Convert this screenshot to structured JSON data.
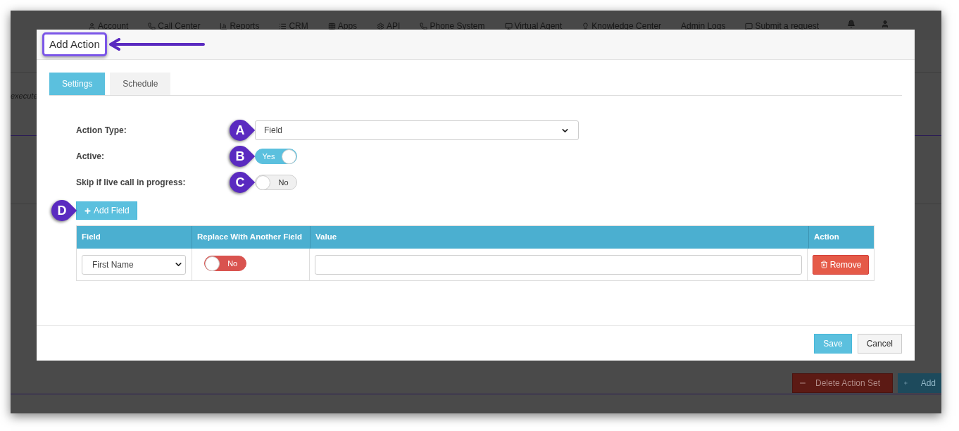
{
  "nav": {
    "items": [
      "Account",
      "Call Center",
      "Reports",
      "CRM",
      "Apps",
      "API",
      "Phone System",
      "Virtual Agent",
      "Knowledge Center",
      "Admin Logs",
      "Submit a request"
    ]
  },
  "background": {
    "note": "execute",
    "buttons": [
      "Delete Action Set",
      "Add"
    ]
  },
  "modal": {
    "title": "Add Action",
    "tabs": [
      {
        "label": "Settings",
        "selected": true
      },
      {
        "label": "Schedule",
        "selected": false
      }
    ],
    "form": [
      {
        "label": "Action Type:",
        "kind": "select",
        "value": "Field",
        "marker": "A"
      },
      {
        "label": "Active:",
        "kind": "toggle",
        "on": true,
        "text": "Yes",
        "marker": "B"
      },
      {
        "label": "Skip if live call in progress:",
        "kind": "toggle",
        "on": false,
        "text": "No",
        "marker": "C"
      }
    ],
    "add_button": {
      "label": "Add Field",
      "marker": "D"
    },
    "table": {
      "columns": [
        "Field",
        "Replace With Another Field",
        "Value",
        "Action"
      ],
      "rows": [
        {
          "field": "First Name",
          "replace": {
            "on": false,
            "text": "No"
          },
          "action": "Remove"
        }
      ]
    },
    "buttons": [
      "Save",
      "Cancel"
    ]
  }
}
